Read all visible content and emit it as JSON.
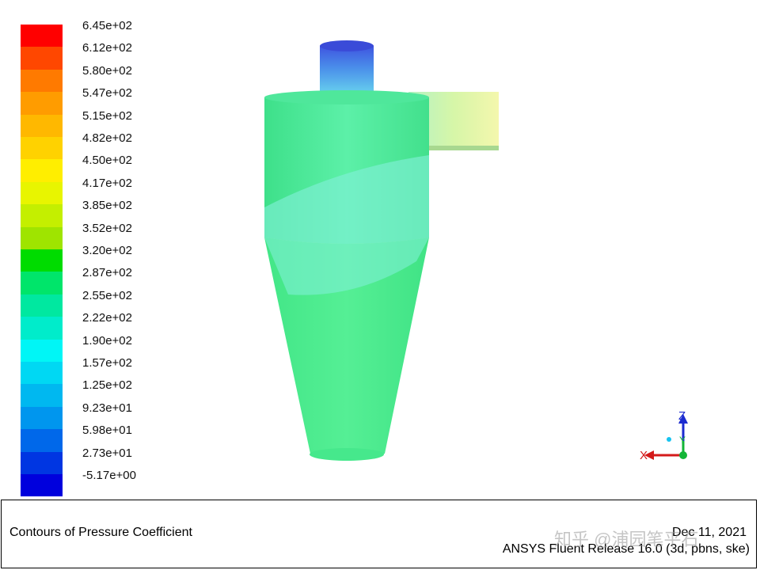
{
  "legend": {
    "ticks": [
      "6.45e+02",
      "6.12e+02",
      "5.80e+02",
      "5.47e+02",
      "5.15e+02",
      "4.82e+02",
      "4.50e+02",
      "4.17e+02",
      "3.85e+02",
      "3.52e+02",
      "3.20e+02",
      "2.87e+02",
      "2.55e+02",
      "2.22e+02",
      "1.90e+02",
      "1.57e+02",
      "1.25e+02",
      "9.23e+01",
      "5.98e+01",
      "2.73e+01",
      "-5.17e+00"
    ],
    "colors": [
      "#ff0000",
      "#ff4700",
      "#ff7a00",
      "#ff9c00",
      "#ffb800",
      "#ffd200",
      "#ffee00",
      "#e8f500",
      "#c4ef00",
      "#9fe400",
      "#00dc00",
      "#00e56a",
      "#00e8a0",
      "#00eccb",
      "#00f6f6",
      "#00d8f3",
      "#00b8f0",
      "#0096ee",
      "#0068ea",
      "#0036e2",
      "#0000dd"
    ]
  },
  "axes": {
    "x": "X",
    "y": "Y",
    "z": "Z"
  },
  "footer": {
    "title": "Contours of Pressure Coefficient",
    "date": "Dec 11, 2021",
    "release": "ANSYS Fluent Release 16.0 (3d, pbns, ske)"
  },
  "watermark": "知乎 @浦园笔平石"
}
